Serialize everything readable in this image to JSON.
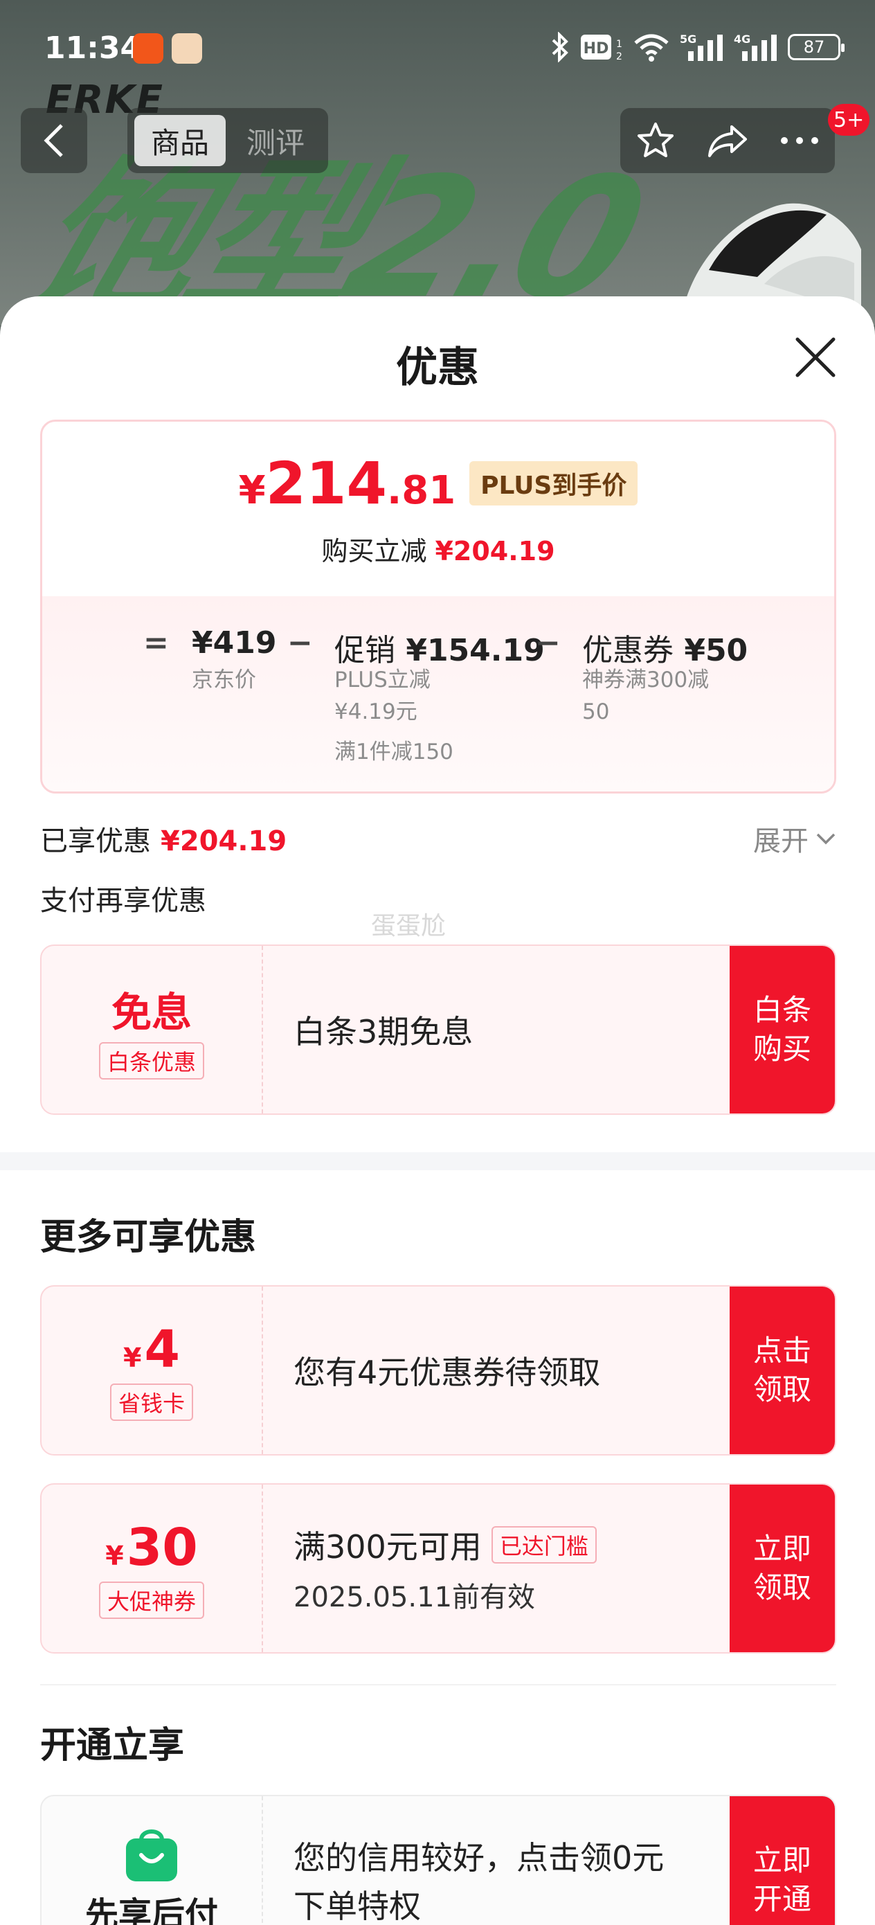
{
  "status_bar": {
    "time": "11:34",
    "battery": "87",
    "icons": [
      "bluetooth-icon",
      "hd-icon",
      "wifi-icon",
      "5g-signal-icon",
      "4g-signal-icon"
    ]
  },
  "banner": {
    "brand": "ERKE",
    "art_text": "饱型2.0"
  },
  "nav": {
    "tabs": [
      "商品",
      "测评"
    ],
    "active_tab": "商品",
    "notification_count": "5+"
  },
  "sheet": {
    "title": "优惠",
    "summary": {
      "price_symbol": "¥",
      "price_int": "214",
      "price_dec": ".81",
      "price_tag": "PLUS到手价",
      "cut_label": "购买立减",
      "cut_value": "¥204.19",
      "calc": {
        "eq": "=",
        "minus": "−",
        "jd_price": "¥419",
        "jd_price_label": "京东价",
        "promo_label": "促销",
        "promo_value": "¥154.19",
        "promo_sub1": "PLUS立减",
        "promo_sub2": "¥4.19元",
        "promo_sub3": "满1件减150",
        "coupon_label": "优惠券",
        "coupon_value": "¥50",
        "coupon_sub1": "神券满300减",
        "coupon_sub2": "50"
      }
    },
    "enjoyed_label": "已享优惠",
    "enjoyed_value": "¥204.19",
    "expand_label": "展开",
    "pay_more": "支付再享优惠",
    "watermark": "蛋蛋尬",
    "baitiao": {
      "value": "免息",
      "tag": "白条优惠",
      "desc": "白条3期免息",
      "button": "白条购买"
    },
    "more_title": "更多可享优惠",
    "coupon_card": {
      "yen": "¥",
      "value": "4",
      "tag": "省钱卡",
      "desc": "您有4元优惠券待领取",
      "button": "点击领取"
    },
    "promo_coupon": {
      "yen": "¥",
      "value": "30",
      "tag": "大促神券",
      "desc": "满300元可用",
      "reached": "已达门槛",
      "expiry": "2025.05.11前有效",
      "button": "立即领取"
    },
    "open_title": "开通立享",
    "paylater": {
      "label": "先享后付",
      "desc_line1": "您的信用较好，点击领0元",
      "desc_line2": "下单特权",
      "button": "立即开通"
    }
  },
  "colors": {
    "brand_red": "#f0152b",
    "plus_tag_bg": "#fce7c4",
    "paylater_green": "#1bbf75"
  }
}
